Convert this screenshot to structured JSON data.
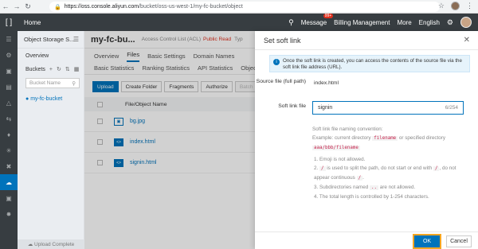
{
  "browser": {
    "url_host": "https://oss.console.aliyun.com",
    "url_path": "/bucket/oss-us-west-1/my-fc-bucket/object"
  },
  "topbar": {
    "home": "Home",
    "message": "Message",
    "message_badge": "99+",
    "billing": "Billing Management",
    "more": "More",
    "language": "English"
  },
  "sidebar": {
    "title": "Object Storage S...",
    "overview": "Overview",
    "buckets": "Buckets",
    "bucket_search_placeholder": "Bucket Name",
    "bucket_item": "my-fc-bucket",
    "upload_complete": "Upload Complete"
  },
  "main": {
    "bucket_name": "my-fc-bu...",
    "acl_label": "Access Control List (ACL)",
    "acl_value": "Public Read",
    "type_label": "Typ",
    "tabs_row1": [
      "Overview",
      "Files",
      "Basic Settings",
      "Domain Names"
    ],
    "tabs_row2": [
      "Basic Statistics",
      "Ranking Statistics",
      "API Statistics",
      "Objec"
    ],
    "toolbar": [
      "Upload",
      "Create Folder",
      "Fragments",
      "Authorize",
      "Batch"
    ],
    "column_header": "File/Object Name",
    "files": [
      {
        "name": "bg.jpg"
      },
      {
        "name": "index.html"
      },
      {
        "name": "signin.html"
      }
    ]
  },
  "panel": {
    "title": "Set soft link",
    "info": "Once the soft link is created, you can access the contents of the source file via the soft link file address (URL).",
    "source_label": "Source file (full path)",
    "source_value": "index.html",
    "link_label": "Soft link file",
    "link_value": "signin",
    "link_count": "6/254",
    "rules_title": "Soft link file naming convention:",
    "example_prefix": "Example: current directory",
    "example_code1": "filename",
    "example_mid": "or specified directory",
    "example_code2": "aaa/bbb/filename",
    "rule1": "1. Emoji is not allowed.",
    "rule2_a": "2.",
    "rule2_code": "/",
    "rule2_b": "is used to split the path, do not start or end with",
    "rule2_code2": "/",
    "rule2_c": ", do not appear continuous",
    "rule2_code3": "/",
    "rule2_d": ".",
    "rule3_a": "3. Subdirectories named",
    "rule3_code": "..",
    "rule3_b": "are not allowed.",
    "rule4": "4. The total length is controlled by 1-254 characters.",
    "ok": "OK",
    "cancel": "Cancel"
  }
}
